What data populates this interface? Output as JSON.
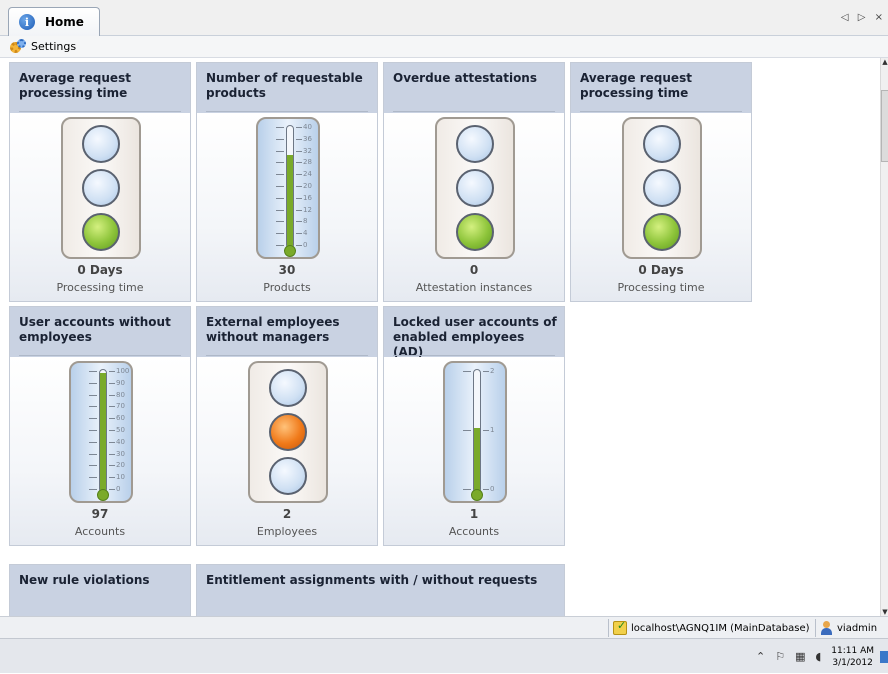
{
  "tab": {
    "label": "Home",
    "nav": "◁ ▷ ×"
  },
  "toolbar": {
    "settings_label": "Settings"
  },
  "cards": [
    {
      "title": "Average request processing time",
      "value": "0 Days",
      "unit": "Processing time",
      "widget": "traffic-light",
      "lamps": [
        "off",
        "off",
        "green"
      ]
    },
    {
      "title": "Number of requestable products",
      "value": "30",
      "unit": "Products",
      "widget": "thermometer",
      "min": 0,
      "max": 40,
      "fill_level": 30
    },
    {
      "title": "Overdue attestations",
      "value": "0",
      "unit": "Attestation instances",
      "widget": "traffic-light",
      "lamps": [
        "off",
        "off",
        "green"
      ]
    },
    {
      "title": "Average request processing time",
      "value": "0 Days",
      "unit": "Processing time",
      "widget": "traffic-light",
      "lamps": [
        "off",
        "off",
        "green"
      ]
    },
    {
      "title": "User accounts without employees",
      "value": "97",
      "unit": "Accounts",
      "widget": "thermometer",
      "min": 0,
      "max": 100,
      "fill_level": 97
    },
    {
      "title": "External employees without managers",
      "value": "2",
      "unit": "Employees",
      "widget": "traffic-light",
      "lamps": [
        "off",
        "orange",
        "off"
      ]
    },
    {
      "title": "Locked user accounts of enabled employees (AD)",
      "value": "1",
      "unit": "Accounts",
      "widget": "thermometer",
      "min": 0,
      "max": 2,
      "fill_level": 1
    },
    {
      "title": "New rule violations"
    },
    {
      "title": "Entitlement assignments with / without requests"
    }
  ],
  "thermo_scales": {
    "products": [
      "40",
      "36",
      "32",
      "28",
      "24",
      "20",
      "16",
      "12",
      "8",
      "4",
      "0"
    ],
    "accounts": [
      "100",
      "90",
      "80",
      "70",
      "60",
      "50",
      "40",
      "30",
      "20",
      "10",
      "0"
    ],
    "locked": [
      "2",
      "1",
      "0"
    ]
  },
  "statusbar": {
    "connection": "localhost\\AGNQ1IM (MainDatabase)",
    "user": "viadmin"
  },
  "taskbar": {
    "time": "11:11 AM",
    "date": "3/1/2012"
  },
  "colors": {
    "header": "#c9d2e2",
    "green_lamp": "#8dc43a",
    "orange_lamp": "#f07a1a",
    "thermo_fill": "#7aaa2a"
  }
}
